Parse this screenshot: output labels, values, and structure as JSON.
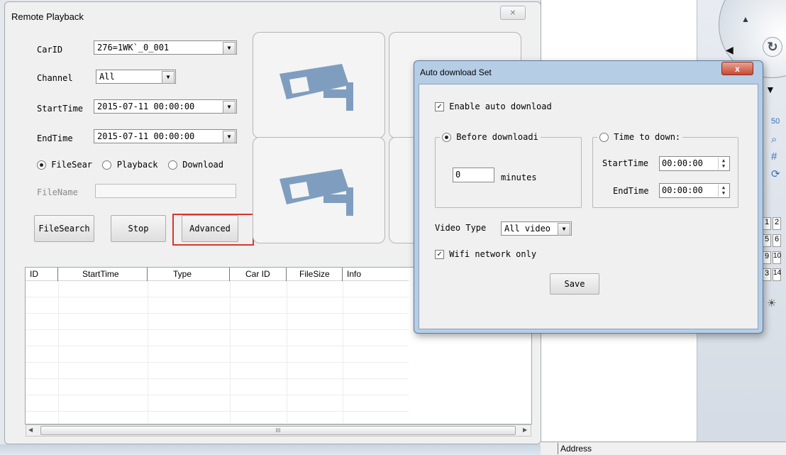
{
  "remote_playback": {
    "title": "Remote Playback",
    "close_glyph": "⨯",
    "carid_label": "CarID",
    "carid_value": "276=1WK`_0_001",
    "channel_label": "Channel",
    "channel_value": "All",
    "starttime_label": "StartTime",
    "starttime_value": "2015-07-11 00:00:00",
    "endtime_label": "EndTime",
    "endtime_value": "2015-07-11 00:00:00",
    "mode_options": [
      "FileSear",
      "Playback",
      "Download"
    ],
    "mode_selected": "FileSear",
    "filename_label": "FileName",
    "filename_value": "",
    "filesearch_button": "FileSearch",
    "stop_button": "Stop",
    "advanced_button": "Advanced",
    "table": {
      "columns": [
        "ID",
        "StartTime",
        "Type",
        "Car ID",
        "FileSize",
        "Info"
      ],
      "rows": []
    },
    "scroll_thumb_glyph": "III"
  },
  "auto_download_dialog": {
    "title": "Auto download Set",
    "close_glyph": "x",
    "enable_label": "Enable auto download",
    "enable_checked": true,
    "before_label": "Before downloadi",
    "before_selected": true,
    "minutes_value": "0",
    "minutes_label": "minutes",
    "time_label": "Time to down:",
    "time_selected": false,
    "starttime_label": "StartTime",
    "starttime_value": "00:00:00",
    "endtime_label": "EndTime",
    "endtime_value": "00:00:00",
    "video_type_label": "Video Type",
    "video_type_value": "All video",
    "wifi_label": "Wifi network only",
    "wifi_checked": true,
    "save_button": "Save"
  },
  "background": {
    "status_address": "Address",
    "side_numbers": [
      "1",
      "2",
      "5",
      "6",
      "9",
      "10",
      "3",
      "14"
    ],
    "zoom_label": "50"
  },
  "colors": {
    "highlight_border": "#d9352f",
    "dialog_frame": "#b6cde6",
    "camera_icon": "#7f9ebf"
  }
}
